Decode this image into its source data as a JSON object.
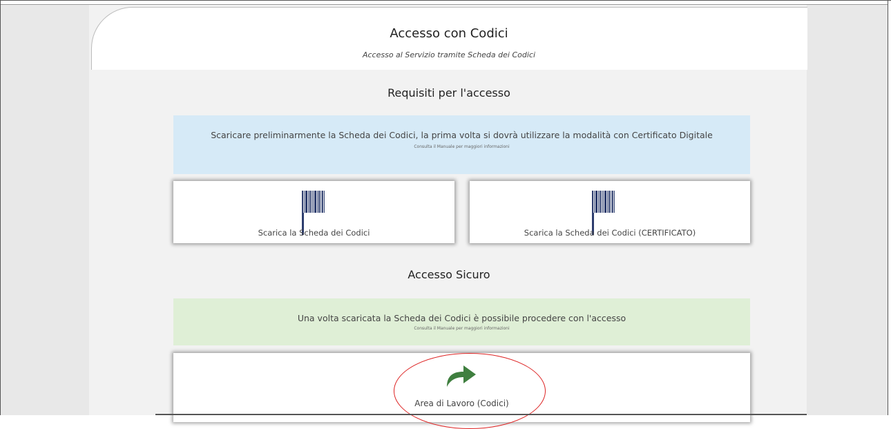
{
  "header": {
    "title": "Accesso con Codici",
    "subtitle": "Accesso al Servizio tramite Scheda dei Codici"
  },
  "requisiti": {
    "title": "Requisiti per l'accesso",
    "note_text": "Scaricare preliminarmente la Scheda dei Codici, la prima volta si dovrà utilizzare la modalità con Certificato Digitale",
    "note_small": "Consulta il Manuale per maggiori informazioni",
    "download_label": "Scarica la Scheda dei Codici",
    "download_cert_label": "Scarica la Scheda dei Codici (CERTIFICATO)",
    "icon": "barcode-icon"
  },
  "accesso": {
    "title": "Accesso Sicuro",
    "note_text": "Una volta scaricata la Scheda dei Codici è possibile procedere con l'accesso",
    "note_small": "Consulta il Manuale per maggiori informazioni",
    "workarea_label": "Area di Lavoro (Codici)",
    "icon": "share-arrow-icon"
  },
  "colors": {
    "info_blue": "#d6eaf7",
    "info_green": "#dfefd6",
    "arrow_green": "#3f7f3f",
    "highlight_red": "#dd2222",
    "barcode": "#2d3d6e"
  }
}
